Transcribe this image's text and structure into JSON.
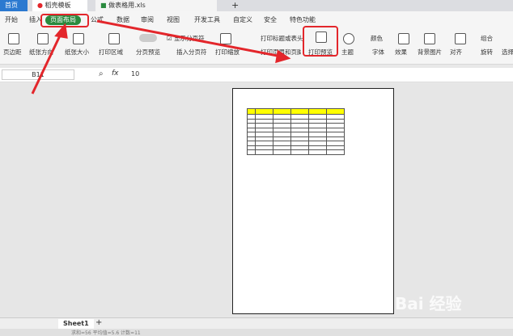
{
  "tabs": {
    "home": "首页",
    "template": "稻壳模板",
    "file": "做表格用.xls",
    "new": "+"
  },
  "ribbon_tabs": [
    "开始",
    "插入",
    "页面布局",
    "公式",
    "数据",
    "审阅",
    "视图",
    "开发工具",
    "自定义",
    "安全",
    "特色功能"
  ],
  "toolbar": {
    "margins": "页边距",
    "orientation": "纸张方向",
    "size": "纸张大小",
    "print_area": "打印区域",
    "page_break_preview": "分页预览",
    "show_breaks": "显示分页符",
    "insert_break": "插入分页符",
    "print_scale": "打印缩放",
    "print_titles": "打印标题或表头",
    "print_header_footer": "打印页眉和页脚",
    "print_preview": "打印预览",
    "theme": "主题",
    "color": "颜色",
    "font": "字体",
    "effect": "效果",
    "background": "背景图片",
    "align": "对齐",
    "group": "组合",
    "rotate": "旋转",
    "select": "选择"
  },
  "formula": {
    "cell_ref": "B11",
    "fx": "fx",
    "value": "10"
  },
  "sheet": {
    "name": "Sheet1",
    "add": "+"
  },
  "status": {
    "text": "求和=56  平均值=5.6  计数=11"
  },
  "watermark": "Bai 经验",
  "colors": {
    "accent": "#2a8a3e",
    "red": "#e3262b",
    "header_yellow": "#ffff00"
  }
}
